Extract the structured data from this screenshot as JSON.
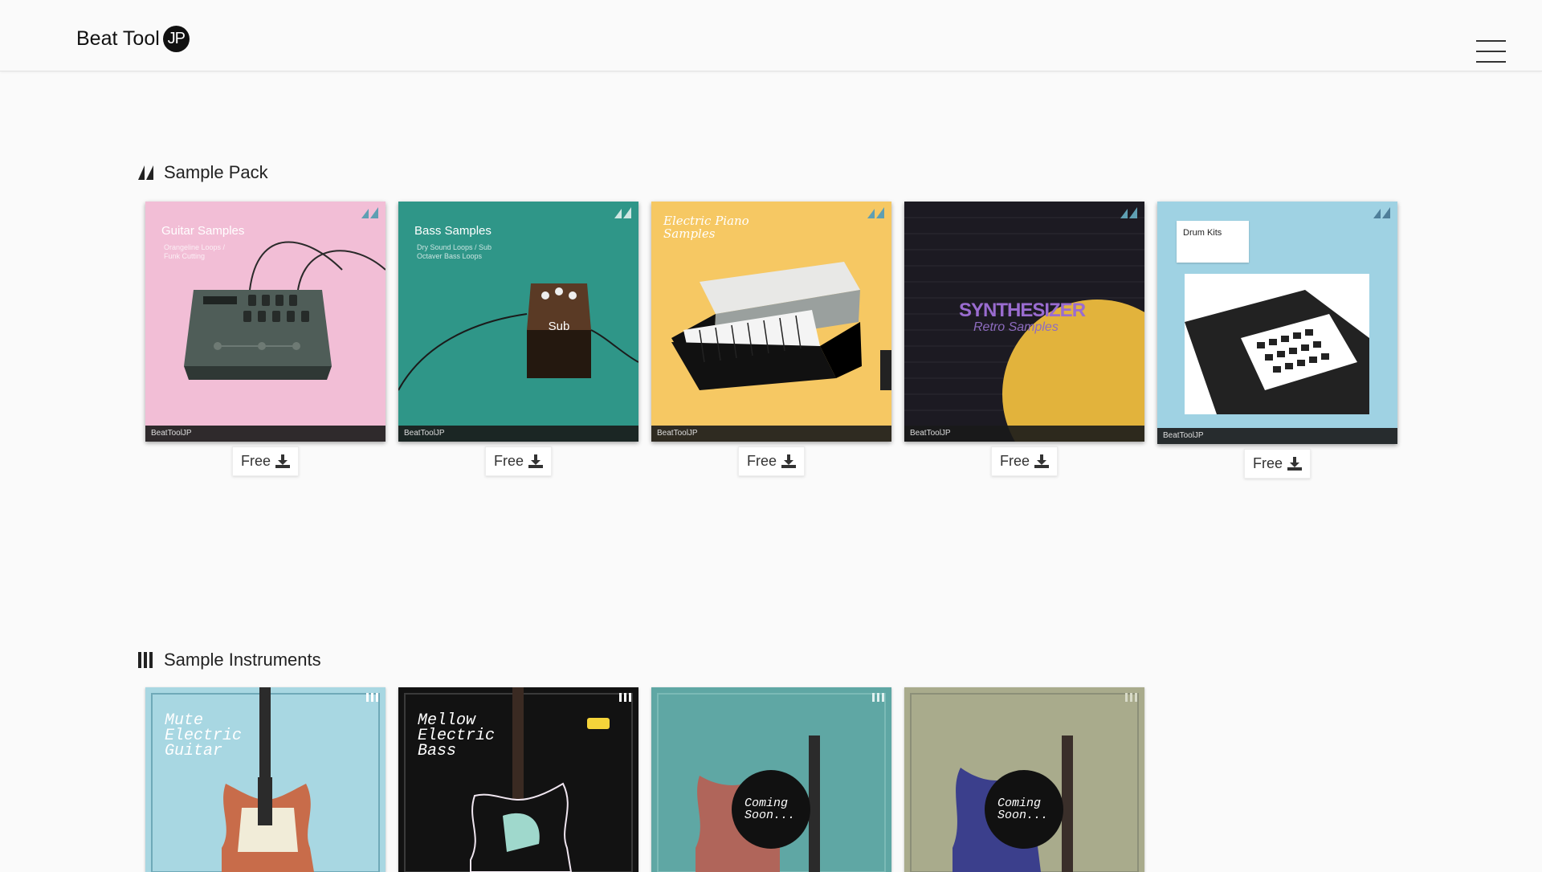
{
  "brand": {
    "text": "Beat Tool",
    "badge": "JP"
  },
  "sections": {
    "sample_pack": {
      "title": "Sample Pack",
      "packs": [
        {
          "name": "Guitar Samples",
          "sub": "Orangeline Loops / Funk Cutting",
          "footer": "BeatToolJP",
          "price": "Free",
          "bg": "#f2bed6"
        },
        {
          "name": "Bass Samples",
          "sub": "Dry Sound Loops / Sub Octaver Bass Loops",
          "footer": "BeatToolJP",
          "price": "Free",
          "bg": "#2f9688"
        },
        {
          "name": "Electric Piano Samples",
          "sub": "",
          "footer": "BeatToolJP",
          "price": "Free",
          "bg": "#f6c863"
        },
        {
          "name": "SYNTHESIZER",
          "sub": "Retro Samples",
          "footer": "BeatToolJP",
          "price": "Free",
          "bg": "#1c1a22"
        },
        {
          "name": "Drum Kits",
          "sub": "",
          "footer": "BeatToolJP",
          "price": "Free",
          "bg": "#9fd2e3"
        }
      ]
    },
    "sample_instruments": {
      "title": "Sample Instruments",
      "items": [
        {
          "title": "Mute Electric Guitar",
          "soon": ""
        },
        {
          "title": "Mellow Electric Bass",
          "soon": ""
        },
        {
          "title": "",
          "soon": "Coming Soon..."
        },
        {
          "title": "",
          "soon": "Coming Soon..."
        }
      ]
    }
  },
  "icons": {
    "menu": "hamburger-menu-icon",
    "download": "download-icon",
    "pack": "sample-pack-icon",
    "instruments": "sample-instruments-icon"
  },
  "colors": {
    "background": "#fafafa",
    "text": "#222222",
    "navbar_border": "#e2e2e2"
  }
}
